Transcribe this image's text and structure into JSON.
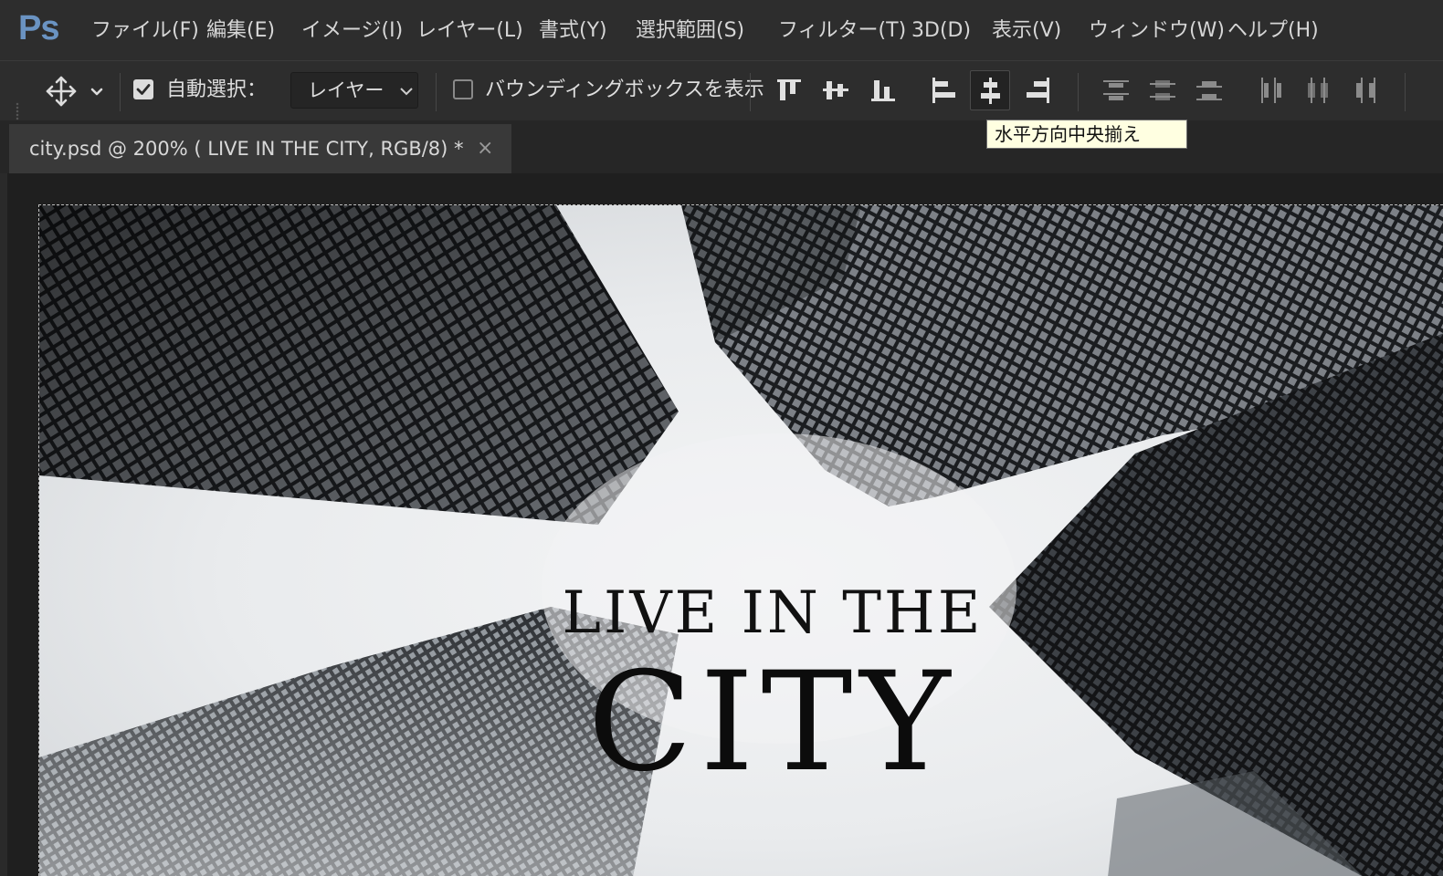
{
  "app": {
    "logo": "Ps"
  },
  "menu": [
    {
      "label": "ファイル(F)"
    },
    {
      "label": "編集(E)"
    },
    {
      "label": "イメージ(I)"
    },
    {
      "label": "レイヤー(L)"
    },
    {
      "label": "書式(Y)"
    },
    {
      "label": "選択範囲(S)"
    },
    {
      "label": "フィルター(T)"
    },
    {
      "label": "3D(D)"
    },
    {
      "label": "表示(V)"
    },
    {
      "label": "ウィンドウ(W)"
    },
    {
      "label": "ヘルプ(H)"
    }
  ],
  "options_bar": {
    "tool_icon": "move-tool-icon",
    "auto_select_label": "自動選択：",
    "auto_select_checked": true,
    "auto_select_target": "レイヤー",
    "bounding_box_label": "バウンディングボックスを表示",
    "bounding_box_checked": false,
    "align_buttons": [
      "align-top-edges-icon",
      "align-vertical-centers-icon",
      "align-bottom-edges-icon",
      "align-left-edges-icon",
      "align-horizontal-centers-icon",
      "align-right-edges-icon"
    ],
    "distribute_buttons": [
      "distribute-top-icon",
      "distribute-vertical-centers-icon",
      "distribute-bottom-icon",
      "distribute-left-icon",
      "distribute-horizontal-centers-icon",
      "distribute-right-icon"
    ],
    "tooltip": "水平方向中央揃え"
  },
  "document_tab": {
    "title": "city.psd @ 200% ( LIVE IN THE CITY, RGB/8) *",
    "close": "×"
  },
  "canvas": {
    "headline_line1": "LIVE IN THE",
    "headline_line2": "CITY"
  },
  "colors": {
    "ui_bg": "#2d2d2d",
    "ps_logo": "#6a93c2",
    "tooltip_bg": "#ffffe1",
    "sky": "#eef0f2",
    "text": "#111111"
  }
}
